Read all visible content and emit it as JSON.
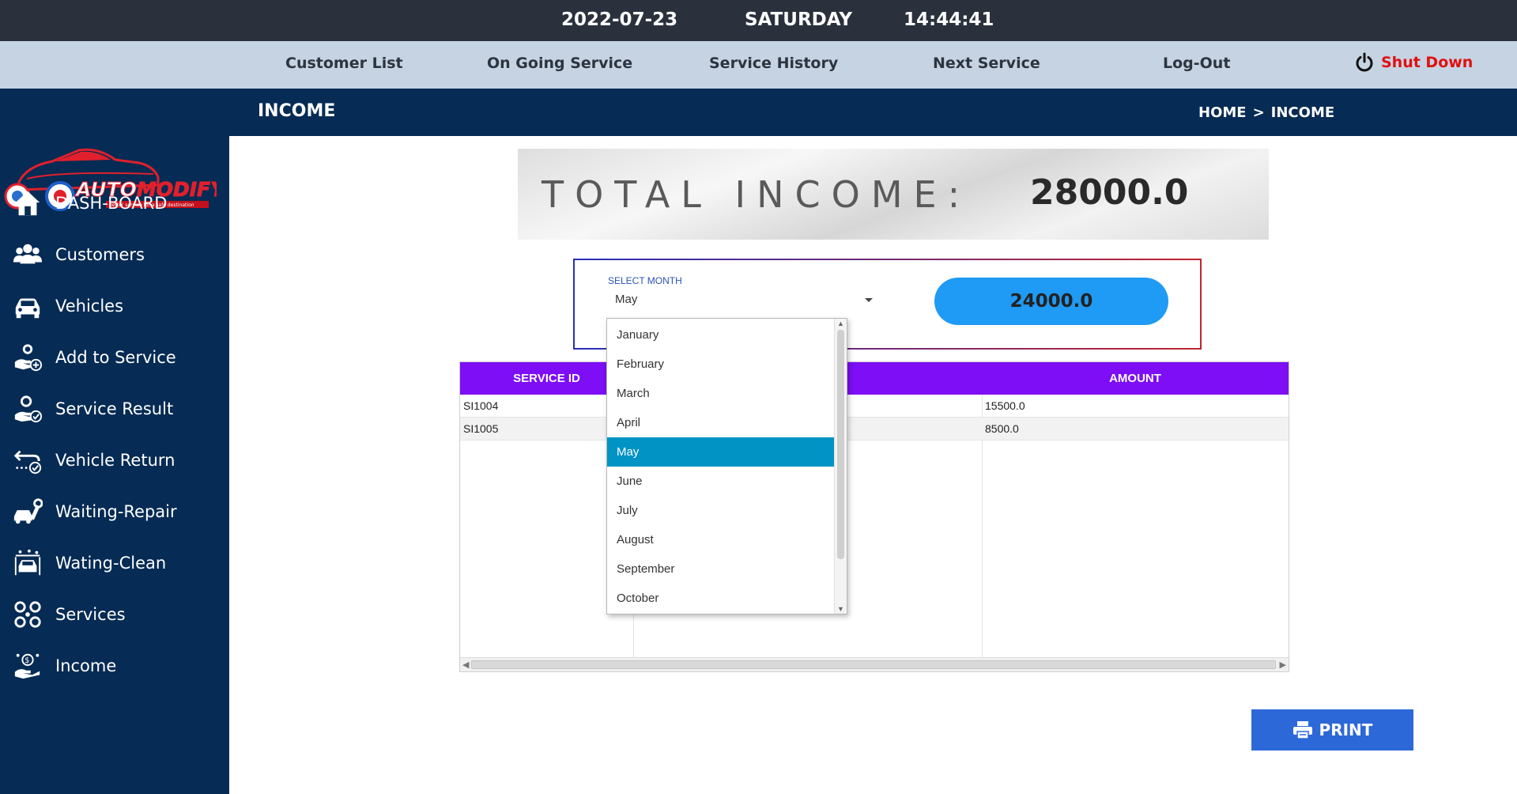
{
  "datebar": {
    "date": "2022-07-23",
    "day": "SATURDAY",
    "time": "14:44:41"
  },
  "nav": {
    "items": [
      "Customer List",
      "On Going Service",
      "Service History",
      "Next Service",
      "Log-Out"
    ],
    "shutdown": "Shut Down",
    "shutdown_color": "#e01010"
  },
  "logo": {
    "brand": "AUTOMODIFY",
    "tagline": "better service for a safe destination"
  },
  "sidebar": {
    "items": [
      {
        "label": "DASH-BOARD",
        "icon": "home-icon"
      },
      {
        "label": "Customers",
        "icon": "users-icon"
      },
      {
        "label": "Vehicles",
        "icon": "car-icon"
      },
      {
        "label": "Add to Service",
        "icon": "add-service-icon"
      },
      {
        "label": "Service Result",
        "icon": "service-result-icon"
      },
      {
        "label": "Vehicle Return",
        "icon": "return-icon"
      },
      {
        "label": "Waiting-Repair",
        "icon": "repair-icon"
      },
      {
        "label": "Wating-Clean",
        "icon": "clean-icon"
      },
      {
        "label": "Services",
        "icon": "services-icon"
      },
      {
        "label": "Income",
        "icon": "income-icon"
      }
    ]
  },
  "header": {
    "title": "INCOME",
    "breadcrumb_home": "HOME",
    "breadcrumb_sep": ">",
    "breadcrumb_current": "INCOME"
  },
  "total": {
    "label": "TOTAL INCOME:",
    "value": "28000.0"
  },
  "month_select": {
    "label": "SELECT MONTH",
    "selected": "May",
    "month_total": "24000.0",
    "options": [
      "January",
      "February",
      "March",
      "April",
      "May",
      "June",
      "July",
      "August",
      "September",
      "October"
    ]
  },
  "table": {
    "columns": [
      "SERVICE ID",
      "",
      "AMOUNT"
    ],
    "rows": [
      [
        "SI1004",
        "",
        "15500.0"
      ],
      [
        "SI1005",
        "",
        "8500.0"
      ]
    ]
  },
  "print": {
    "label": "PRINT"
  },
  "colors": {
    "nav_bg": "#c5d3e2",
    "sidebar_bg": "#062b54",
    "table_header": "#7d0ef5",
    "month_total_bg": "#1f9af5",
    "selected_option": "#0093c4",
    "print_bg": "#2c68d8"
  }
}
